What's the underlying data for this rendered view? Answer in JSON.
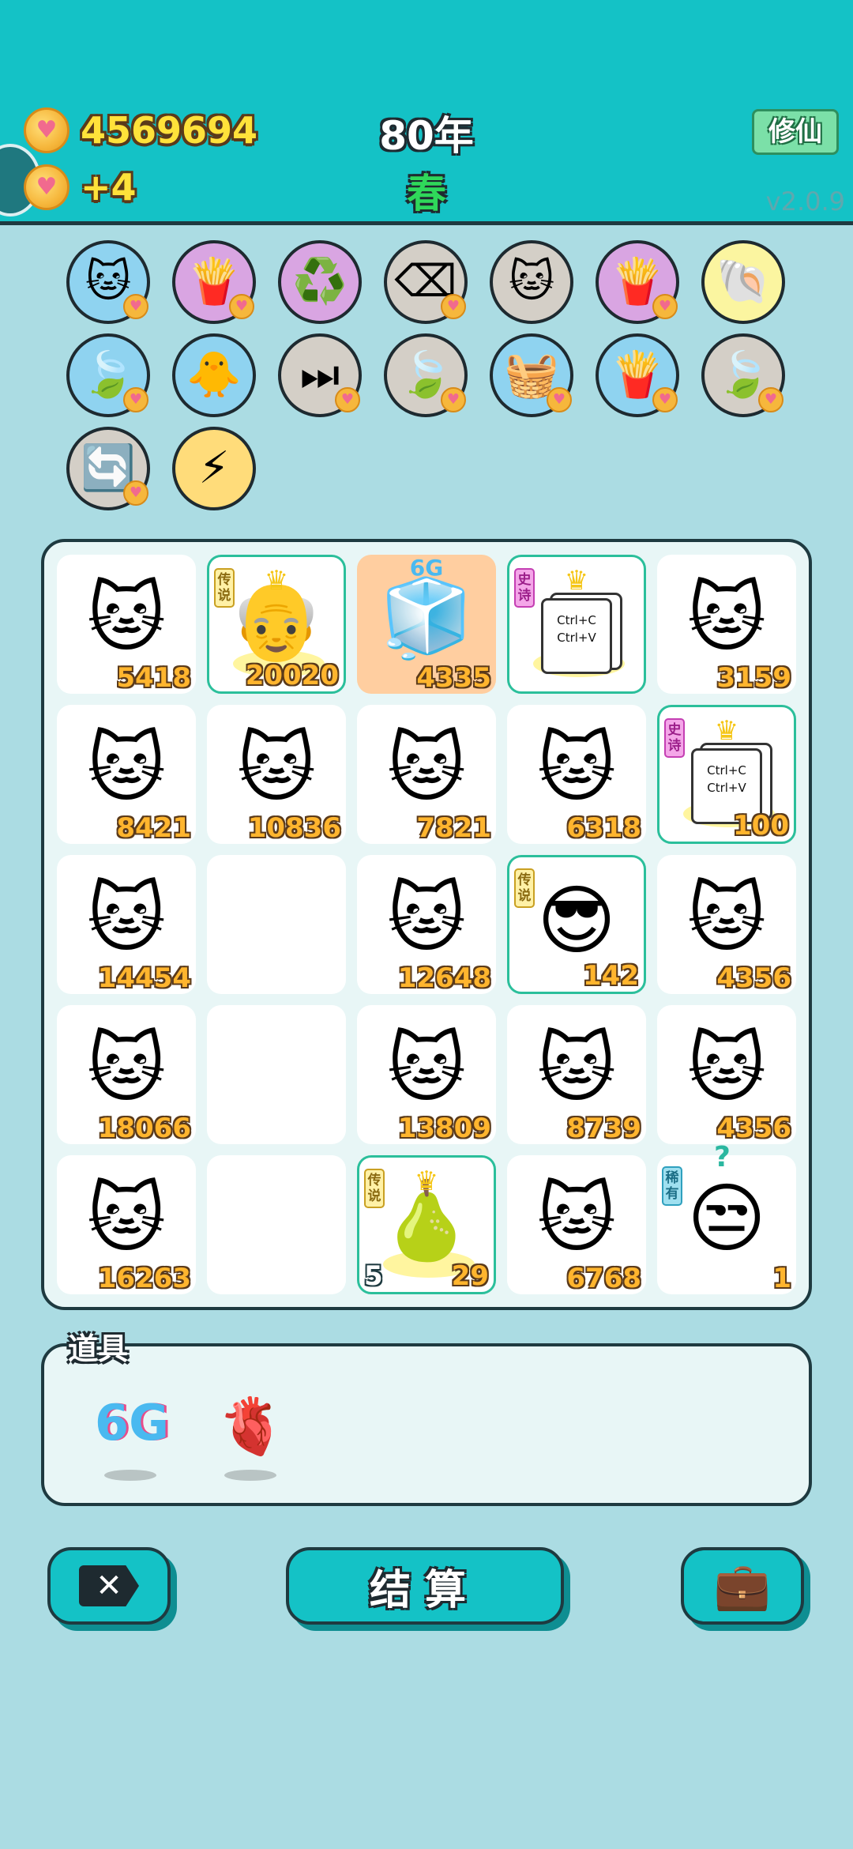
{
  "header": {
    "coins": "4569694",
    "coins_per_turn": "+4",
    "year": "80年",
    "season": "春",
    "mode_button": "修仙",
    "version": "v2.0.9",
    "coin_icon": "heart-coin-icon"
  },
  "buffs": [
    {
      "icon": "🐱",
      "name": "cat-coin-icon",
      "color": "blue",
      "heart": true
    },
    {
      "icon": "🍟",
      "name": "fries-icon",
      "color": "purple",
      "heart": true
    },
    {
      "icon": "♻️",
      "name": "recycle-icon",
      "color": "purple",
      "heart": false
    },
    {
      "icon": "⌫",
      "name": "remove-tag-icon",
      "color": "gray",
      "heart": true
    },
    {
      "icon": "🐱",
      "name": "twin-cats-icon",
      "color": "gray",
      "heart": false
    },
    {
      "icon": "🍟",
      "name": "fries-icon",
      "color": "purple",
      "heart": true
    },
    {
      "icon": "🐚",
      "name": "shell-icon",
      "color": "yellow",
      "heart": false
    },
    {
      "icon": "🍃",
      "name": "leaf-icon",
      "color": "blue",
      "heart": true
    },
    {
      "icon": "🐥",
      "name": "chick-egg-icon",
      "color": "blue",
      "heart": false
    },
    {
      "icon": "⏭",
      "name": "skip-icon",
      "color": "gray",
      "heart": true
    },
    {
      "icon": "🍃",
      "name": "leaf-icon",
      "color": "gray",
      "heart": true
    },
    {
      "icon": "🧺",
      "name": "fruit-basket-icon",
      "color": "blue",
      "heart": true
    },
    {
      "icon": "🍟",
      "name": "fries-icon",
      "color": "blue",
      "heart": true
    },
    {
      "icon": "🍃",
      "name": "leaf-icon",
      "color": "gray",
      "heart": true
    },
    {
      "icon": "🔄",
      "name": "refresh-icon",
      "color": "gray",
      "heart": true
    },
    {
      "icon": "⚡",
      "name": "lightning-icon",
      "color": "orange",
      "heart": false
    }
  ],
  "board": [
    {
      "type": "cat",
      "icon": "🐱",
      "value": "5418"
    },
    {
      "type": "legend",
      "tag": "传说",
      "icon": "👴",
      "value": "20020",
      "crown": true
    },
    {
      "type": "fridge",
      "icon": "🧊",
      "value": "4335",
      "label": "6G"
    },
    {
      "type": "epic-copy",
      "tag": "史诗",
      "value": "",
      "crown": true,
      "text1": "Ctrl+C",
      "text2": "Ctrl+V"
    },
    {
      "type": "cat",
      "icon": "🐱",
      "value": "3159"
    },
    {
      "type": "cat",
      "icon": "🐱",
      "value": "8421"
    },
    {
      "type": "cat",
      "icon": "🐱",
      "value": "10836"
    },
    {
      "type": "cat",
      "icon": "🐱",
      "value": "7821"
    },
    {
      "type": "cat",
      "icon": "🐱",
      "value": "6318"
    },
    {
      "type": "epic-copy",
      "tag": "史诗",
      "value": "100",
      "crown": true,
      "text1": "Ctrl+C",
      "text2": "Ctrl+V"
    },
    {
      "type": "cat",
      "icon": "🐱",
      "value": "14454"
    },
    {
      "type": "empty"
    },
    {
      "type": "cat",
      "icon": "🐱",
      "value": "12648"
    },
    {
      "type": "legend",
      "tag": "传说",
      "icon": "😎",
      "value": "142",
      "crown": false
    },
    {
      "type": "cat",
      "icon": "🐱",
      "value": "4356"
    },
    {
      "type": "cat",
      "icon": "🐱",
      "value": "18066"
    },
    {
      "type": "empty"
    },
    {
      "type": "cat",
      "icon": "🐱",
      "value": "13809"
    },
    {
      "type": "cat",
      "icon": "🐱",
      "value": "8739"
    },
    {
      "type": "cat",
      "icon": "🐱",
      "value": "4356"
    },
    {
      "type": "cat",
      "icon": "🐱",
      "value": "16263"
    },
    {
      "type": "empty"
    },
    {
      "type": "legend",
      "tag": "传说",
      "icon": "🍐",
      "value": "29",
      "left_value": "5",
      "crown": true
    },
    {
      "type": "cat",
      "icon": "🐱",
      "value": "6768"
    },
    {
      "type": "rare",
      "tag": "稀有",
      "icon": "😒",
      "value": "1",
      "question": "?"
    }
  ],
  "items": {
    "label": "道具",
    "list": [
      {
        "name": "6g-item",
        "text": "6G"
      },
      {
        "name": "liver-item",
        "icon": "🫀"
      }
    ]
  },
  "buttons": {
    "settle_label": "结算",
    "close_icon": "✕",
    "bag_icon": "💼"
  }
}
